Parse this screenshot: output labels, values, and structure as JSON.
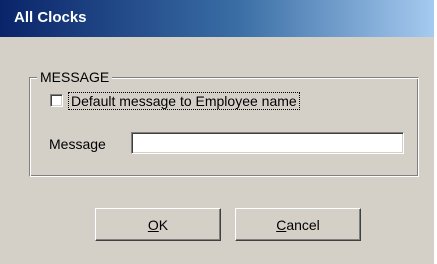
{
  "window": {
    "title": "All Clocks"
  },
  "message_group": {
    "label": "MESSAGE",
    "checkbox_label": "Default message to Employee name",
    "checkbox_checked": false,
    "message_label": "Message",
    "message_value": ""
  },
  "buttons": {
    "ok_accel": "O",
    "ok_rest": "K",
    "cancel_accel": "C",
    "cancel_rest": "ancel"
  }
}
